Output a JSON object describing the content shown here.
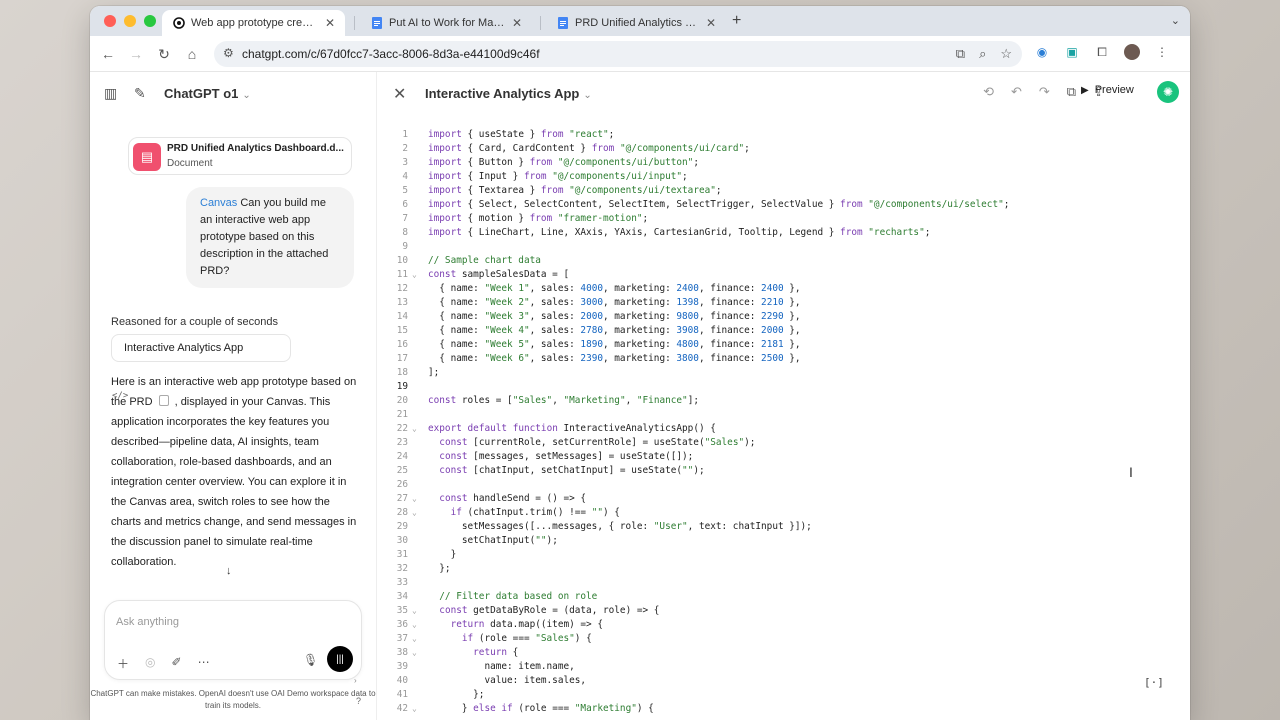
{
  "browser": {
    "tabs": [
      {
        "title": "Web app prototype creation",
        "icon": "openai-icon",
        "active": true
      },
      {
        "title": "Put AI to Work for Marketing T",
        "icon": "docs-icon",
        "active": false
      },
      {
        "title": "PRD Unified Analytics Dashbo",
        "icon": "docs-icon",
        "active": false
      }
    ],
    "new_tab": "+",
    "url": "chatgpt.com/c/67d0fcc7-3acc-8006-8d3a-e44100d9c46f"
  },
  "chat": {
    "model": "ChatGPT o1",
    "attachment": {
      "name": "PRD Unified Analytics Dashboard.d...",
      "type": "Document"
    },
    "user_message": {
      "tag": "Canvas",
      "text": " Can you build me an interactive web app prototype based on this description in the attached PRD?"
    },
    "reasoned": "Reasoned for a couple of seconds",
    "canvas_chip": "Interactive Analytics App",
    "answer_part1": "Here is an interactive web app prototype based on the PRD",
    "answer_part2": ", displayed in your Canvas. This application incorporates the key features you described—pipeline data, AI insights, team collaboration, role-based dashboards, and an integration center overview. You can explore it in the Canvas area, switch roles to see how the charts and metrics change, and send messages in the discussion panel to simulate real-time collaboration.",
    "composer_placeholder": "Ask anything",
    "disclaimer": "ChatGPT can make mistakes. OpenAI doesn't use OAI Demo workspace data to train its models.",
    "help": "?"
  },
  "canvas": {
    "title": "Interactive Analytics App",
    "preview_label": "Preview",
    "code_lines": [
      {
        "n": "1",
        "fold": "",
        "t": "import { useState } from \"react\";"
      },
      {
        "n": "2",
        "fold": "",
        "t": "import { Card, CardContent } from \"@/components/ui/card\";"
      },
      {
        "n": "3",
        "fold": "",
        "t": "import { Button } from \"@/components/ui/button\";"
      },
      {
        "n": "4",
        "fold": "",
        "t": "import { Input } from \"@/components/ui/input\";"
      },
      {
        "n": "5",
        "fold": "",
        "t": "import { Textarea } from \"@/components/ui/textarea\";"
      },
      {
        "n": "6",
        "fold": "",
        "t": "import { Select, SelectContent, SelectItem, SelectTrigger, SelectValue } from \"@/components/ui/select\";"
      },
      {
        "n": "7",
        "fold": "",
        "t": "import { motion } from \"framer-motion\";"
      },
      {
        "n": "8",
        "fold": "",
        "t": "import { LineChart, Line, XAxis, YAxis, CartesianGrid, Tooltip, Legend } from \"recharts\";"
      },
      {
        "n": "9",
        "fold": "",
        "t": ""
      },
      {
        "n": "10",
        "fold": "",
        "t": "// Sample chart data"
      },
      {
        "n": "11",
        "fold": "⌄",
        "t": "const sampleSalesData = ["
      },
      {
        "n": "12",
        "fold": "",
        "t": "  { name: \"Week 1\", sales: 4000, marketing: 2400, finance: 2400 },"
      },
      {
        "n": "13",
        "fold": "",
        "t": "  { name: \"Week 2\", sales: 3000, marketing: 1398, finance: 2210 },"
      },
      {
        "n": "14",
        "fold": "",
        "t": "  { name: \"Week 3\", sales: 2000, marketing: 9800, finance: 2290 },"
      },
      {
        "n": "15",
        "fold": "",
        "t": "  { name: \"Week 4\", sales: 2780, marketing: 3908, finance: 2000 },"
      },
      {
        "n": "16",
        "fold": "",
        "t": "  { name: \"Week 5\", sales: 1890, marketing: 4800, finance: 2181 },"
      },
      {
        "n": "17",
        "fold": "",
        "t": "  { name: \"Week 6\", sales: 2390, marketing: 3800, finance: 2500 },"
      },
      {
        "n": "18",
        "fold": "",
        "t": "];"
      },
      {
        "n": "19",
        "fold": "",
        "t": ""
      },
      {
        "n": "20",
        "fold": "",
        "t": "const roles = [\"Sales\", \"Marketing\", \"Finance\"];"
      },
      {
        "n": "21",
        "fold": "",
        "t": ""
      },
      {
        "n": "22",
        "fold": "⌄",
        "t": "export default function InteractiveAnalyticsApp() {"
      },
      {
        "n": "23",
        "fold": "",
        "t": "  const [currentRole, setCurrentRole] = useState(\"Sales\");"
      },
      {
        "n": "24",
        "fold": "",
        "t": "  const [messages, setMessages] = useState([]);"
      },
      {
        "n": "25",
        "fold": "",
        "t": "  const [chatInput, setChatInput] = useState(\"\");"
      },
      {
        "n": "26",
        "fold": "",
        "t": ""
      },
      {
        "n": "27",
        "fold": "⌄",
        "t": "  const handleSend = () => {"
      },
      {
        "n": "28",
        "fold": "⌄",
        "t": "    if (chatInput.trim() !== \"\") {"
      },
      {
        "n": "29",
        "fold": "",
        "t": "      setMessages([...messages, { role: \"User\", text: chatInput }]);"
      },
      {
        "n": "30",
        "fold": "",
        "t": "      setChatInput(\"\");"
      },
      {
        "n": "31",
        "fold": "",
        "t": "    }"
      },
      {
        "n": "32",
        "fold": "",
        "t": "  };"
      },
      {
        "n": "33",
        "fold": "",
        "t": ""
      },
      {
        "n": "34",
        "fold": "",
        "t": "  // Filter data based on role"
      },
      {
        "n": "35",
        "fold": "⌄",
        "t": "  const getDataByRole = (data, role) => {"
      },
      {
        "n": "36",
        "fold": "⌄",
        "t": "    return data.map((item) => {"
      },
      {
        "n": "37",
        "fold": "⌄",
        "t": "      if (role === \"Sales\") {"
      },
      {
        "n": "38",
        "fold": "⌄",
        "t": "        return {"
      },
      {
        "n": "39",
        "fold": "",
        "t": "          name: item.name,"
      },
      {
        "n": "40",
        "fold": "",
        "t": "          value: item.sales,"
      },
      {
        "n": "41",
        "fold": "",
        "t": "        };"
      },
      {
        "n": "42",
        "fold": "⌄",
        "t": "      } else if (role === \"Marketing\") {"
      }
    ],
    "current_line": "19"
  },
  "colors": {
    "accent": "#2b7fd6",
    "doc_icon": "#f0506e",
    "openai_green": "#19c37d",
    "code_keyword": "#7a3eb1",
    "code_string": "#2e7d32",
    "code_number": "#1565c0",
    "code_comment": "#2e7d32"
  }
}
